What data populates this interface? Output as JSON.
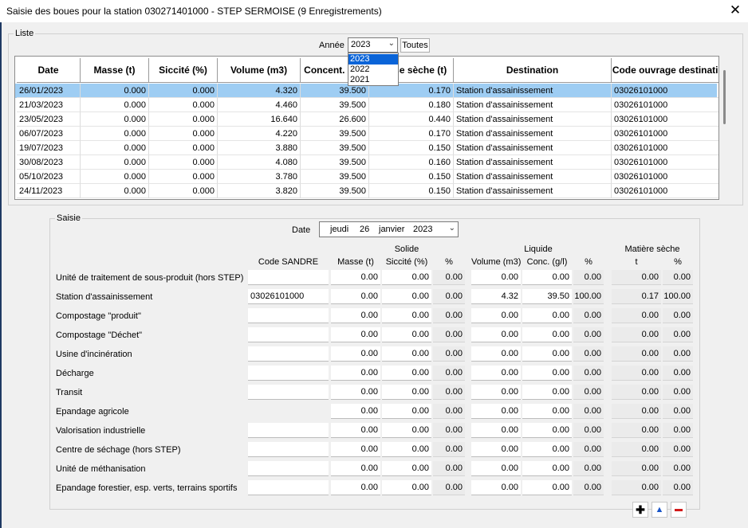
{
  "window": {
    "title": "Saisie des boues pour la station 030271401000 - STEP SERMOISE (9 Enregistrements)",
    "close_glyph": "✕"
  },
  "liste": {
    "legend": "Liste",
    "year_label": "Année",
    "year_value": "2023",
    "year_options": [
      "2023",
      "2022",
      "2021"
    ],
    "toutes_label": "Toutes",
    "columns": [
      "Date",
      "Masse (t)",
      "Siccité (%)",
      "Volume (m3)",
      "Concent. (g/l)",
      "Masse sèche (t)",
      "Destination",
      "Code ouvrage destination"
    ],
    "rows": [
      [
        "26/01/2023",
        "0.000",
        "0.000",
        "4.320",
        "39.500",
        "0.170",
        "Station d'assainissement",
        "03026101000"
      ],
      [
        "21/03/2023",
        "0.000",
        "0.000",
        "4.460",
        "39.500",
        "0.180",
        "Station d'assainissement",
        "03026101000"
      ],
      [
        "23/05/2023",
        "0.000",
        "0.000",
        "16.640",
        "26.600",
        "0.440",
        "Station d'assainissement",
        "03026101000"
      ],
      [
        "06/07/2023",
        "0.000",
        "0.000",
        "4.220",
        "39.500",
        "0.170",
        "Station d'assainissement",
        "03026101000"
      ],
      [
        "19/07/2023",
        "0.000",
        "0.000",
        "3.880",
        "39.500",
        "0.150",
        "Station d'assainissement",
        "03026101000"
      ],
      [
        "30/08/2023",
        "0.000",
        "0.000",
        "4.080",
        "39.500",
        "0.160",
        "Station d'assainissement",
        "03026101000"
      ],
      [
        "05/10/2023",
        "0.000",
        "0.000",
        "3.780",
        "39.500",
        "0.150",
        "Station d'assainissement",
        "03026101000"
      ],
      [
        "24/11/2023",
        "0.000",
        "0.000",
        "3.820",
        "39.500",
        "0.150",
        "Station d'assainissement",
        "03026101000"
      ]
    ]
  },
  "saisie": {
    "legend": "Saisie",
    "date_label": "Date",
    "date_parts": {
      "weekday": "jeudi",
      "day": "26",
      "month": "janvier",
      "year": "2023"
    },
    "groups": {
      "solide": "Solide",
      "liquide": "Liquide",
      "matiere": "Matière sèche"
    },
    "col_headers": {
      "code": "Code SANDRE",
      "masse": "Masse (t)",
      "siccite": "Siccité (%)",
      "pct1": "%",
      "volume": "Volume (m3)",
      "conc": "Conc. (g/l)",
      "pct2": "%",
      "t": "t",
      "pct3": "%"
    },
    "rows": [
      {
        "label": "Unité de traitement de sous-produit (hors STEP)",
        "code": "",
        "values": [
          "0.00",
          "0.00",
          "0.00",
          "0.00",
          "0.00",
          "0.00",
          "0.00",
          "0.00"
        ]
      },
      {
        "label": "Station d'assainissement",
        "code": "03026101000",
        "values": [
          "0.00",
          "0.00",
          "0.00",
          "4.32",
          "39.50",
          "100.00",
          "0.17",
          "100.00"
        ]
      },
      {
        "label": "Compostage \"produit\"",
        "code": "",
        "values": [
          "0.00",
          "0.00",
          "0.00",
          "0.00",
          "0.00",
          "0.00",
          "0.00",
          "0.00"
        ]
      },
      {
        "label": "Compostage \"Déchet\"",
        "code": "",
        "values": [
          "0.00",
          "0.00",
          "0.00",
          "0.00",
          "0.00",
          "0.00",
          "0.00",
          "0.00"
        ]
      },
      {
        "label": "Usine d'incinération",
        "code": "",
        "values": [
          "0.00",
          "0.00",
          "0.00",
          "0.00",
          "0.00",
          "0.00",
          "0.00",
          "0.00"
        ]
      },
      {
        "label": "Décharge",
        "code": "",
        "values": [
          "0.00",
          "0.00",
          "0.00",
          "0.00",
          "0.00",
          "0.00",
          "0.00",
          "0.00"
        ]
      },
      {
        "label": "Transit",
        "code": "",
        "values": [
          "0.00",
          "0.00",
          "0.00",
          "0.00",
          "0.00",
          "0.00",
          "0.00",
          "0.00"
        ]
      },
      {
        "label": "Epandage agricole",
        "code": null,
        "values": [
          "0.00",
          "0.00",
          "0.00",
          "0.00",
          "0.00",
          "0.00",
          "0.00",
          "0.00"
        ]
      },
      {
        "label": "Valorisation industrielle",
        "code": "",
        "values": [
          "0.00",
          "0.00",
          "0.00",
          "0.00",
          "0.00",
          "0.00",
          "0.00",
          "0.00"
        ]
      },
      {
        "label": "Centre de séchage (hors STEP)",
        "code": "",
        "values": [
          "0.00",
          "0.00",
          "0.00",
          "0.00",
          "0.00",
          "0.00",
          "0.00",
          "0.00"
        ]
      },
      {
        "label": "Unité de méthanisation",
        "code": "",
        "values": [
          "0.00",
          "0.00",
          "0.00",
          "0.00",
          "0.00",
          "0.00",
          "0.00",
          "0.00"
        ]
      },
      {
        "label": "Epandage forestier, esp. verts, terrains sportifs",
        "code": "",
        "values": [
          "0.00",
          "0.00",
          "0.00",
          "0.00",
          "0.00",
          "0.00",
          "0.00",
          "0.00"
        ]
      }
    ],
    "buttons": {
      "add": {
        "glyph": "✚",
        "color": "#000000"
      },
      "up": {
        "glyph": "▲",
        "color": "#1a56c8"
      },
      "remove": {
        "glyph": "▬",
        "color": "#d21a1a"
      }
    }
  },
  "colors": {
    "selected_row": "#9ecdf3",
    "dropdown_highlight": "#0a64d8"
  }
}
